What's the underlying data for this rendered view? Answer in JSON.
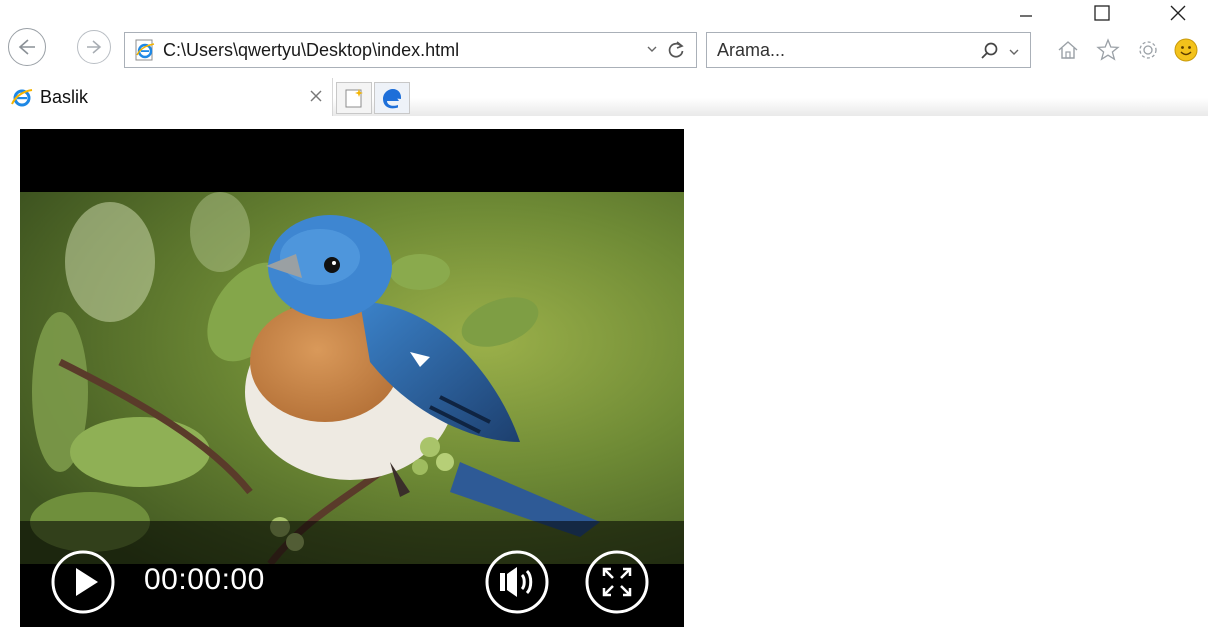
{
  "window": {
    "minimize_icon": "minimize-icon",
    "maximize_icon": "maximize-icon",
    "close_icon": "close-icon"
  },
  "address_bar": {
    "url": "C:\\Users\\qwertyu\\Desktop\\index.html"
  },
  "search": {
    "placeholder": "Arama..."
  },
  "tabs": [
    {
      "label": "Baslik",
      "icon": "ie-icon"
    }
  ],
  "video": {
    "time": "00:00:00",
    "play_icon": "play-icon",
    "volume_icon": "volume-icon",
    "fullscreen_icon": "fullscreen-icon"
  },
  "colors": {
    "ie_blue": "#1e88e5",
    "ie_gold": "#f5b400",
    "smiley": "#f3c21b"
  }
}
